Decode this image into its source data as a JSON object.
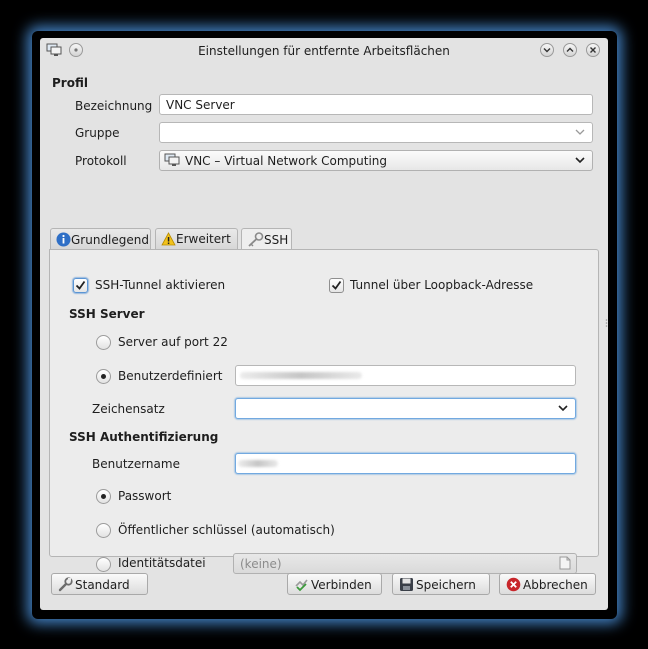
{
  "window": {
    "title": "Einstellungen für entfernte Arbeitsflächen"
  },
  "profile": {
    "section_title": "Profil",
    "name_label": "Bezeichnung",
    "name_value": "VNC Server",
    "group_label": "Gruppe",
    "group_value": "",
    "protocol_label": "Protokoll",
    "protocol_value": "VNC – Virtual Network Computing"
  },
  "tabs": [
    {
      "label": "Grundlegend",
      "icon": "info-icon"
    },
    {
      "label": "Erweitert",
      "icon": "warning-icon"
    },
    {
      "label": "SSH",
      "icon": "key-icon",
      "active": true
    }
  ],
  "ssh": {
    "enable_tunnel_label": "SSH-Tunnel aktivieren",
    "enable_tunnel_checked": true,
    "loopback_label": "Tunnel über Loopback-Adresse",
    "loopback_checked": true,
    "server_section": "SSH Server",
    "server_port22_label": "Server auf port 22",
    "server_custom_label": "Benutzerdefiniert",
    "server_selected": "custom",
    "charset_label": "Zeichensatz",
    "charset_value": "",
    "auth_section": "SSH Authentifizierung",
    "username_label": "Benutzername",
    "auth_password_label": "Passwort",
    "auth_pubkey_label": "Öffentlicher schlüssel (automatisch)",
    "auth_identity_label": "Identitätsdatei",
    "identity_file_value": "(keine)",
    "auth_selected": "password"
  },
  "buttons": {
    "standard": "Standard",
    "connect": "Verbinden",
    "save": "Speichern",
    "cancel": "Abbrechen"
  },
  "colors": {
    "glow": "#58aaff",
    "window_bg": "#e3e3e3",
    "focus": "#72a9e0",
    "cancel_red": "#c8262b"
  }
}
